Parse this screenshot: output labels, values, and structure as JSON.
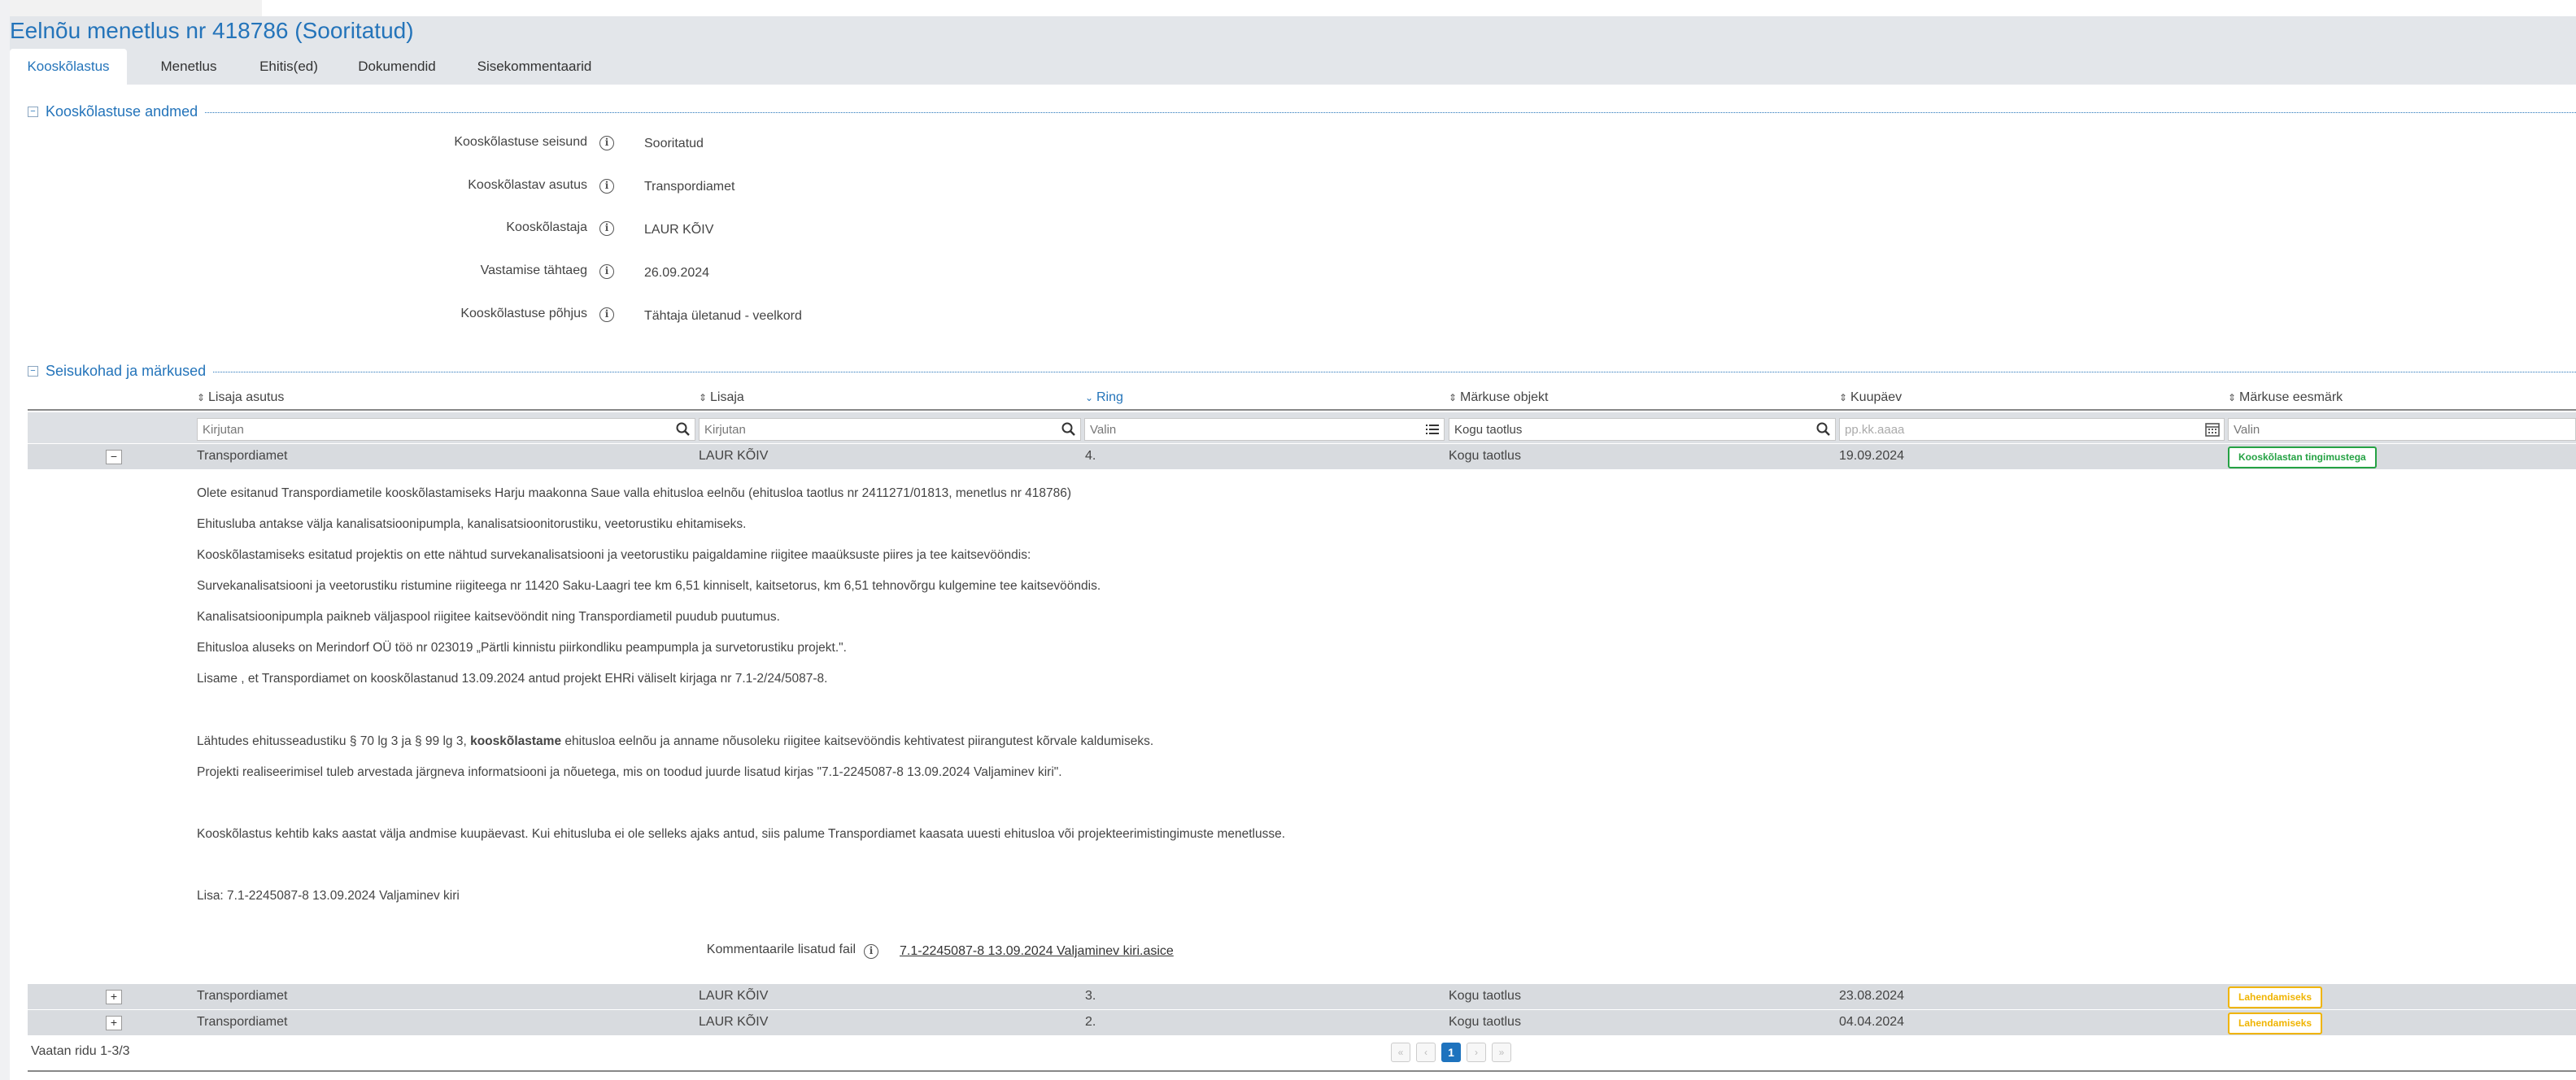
{
  "page": {
    "title": "Eelnõu menetlus nr 418786 (Sooritatud)"
  },
  "tabs": [
    {
      "label": "Kooskõlastus",
      "active": true
    },
    {
      "label": "Menetlus"
    },
    {
      "label": "Ehitis(ed)"
    },
    {
      "label": "Dokumendid"
    },
    {
      "label": "Sisekommentaarid"
    }
  ],
  "section1": {
    "title": "Kooskõlastuse andmed",
    "collapse_glyph": "−",
    "info_glyph": "i",
    "fields": [
      {
        "label": "Kooskõlastuse seisund",
        "value": "Sooritatud"
      },
      {
        "label": "Kooskõlastav asutus",
        "value": "Transpordiamet"
      },
      {
        "label": "Kooskõlastaja",
        "value": "LAUR KÕIV"
      },
      {
        "label": "Vastamise tähtaeg",
        "value": "26.09.2024"
      },
      {
        "label": "Kooskõlastuse põhjus",
        "value": "Tähtaja ületanud - veelkord"
      }
    ]
  },
  "section2": {
    "title": "Seisukohad ja märkused",
    "collapse_glyph": "−",
    "sort_glyph": "⇕",
    "sorted_glyph": "⌄",
    "columns": [
      "Lisaja asutus",
      "Lisaja",
      "Ring",
      "Märkuse objekt",
      "Kuupäev",
      "Märkuse eesmärk"
    ],
    "filters": {
      "asutus": "Kirjutan",
      "lisaja": "Kirjutan",
      "ring": "Valin",
      "objekt": "Kogu taotlus",
      "kuupaev": "pp.kk.aaaa",
      "eesmark": "Valin"
    },
    "rows": [
      {
        "toggle": "−",
        "asutus": "Transpordiamet",
        "lisaja": "LAUR KÕIV",
        "ring": "4.",
        "objekt": "Kogu taotlus",
        "kuupaev": "19.09.2024",
        "eesmark": "Kooskõlastan tingimustega",
        "status_color": "#25a244"
      },
      {
        "toggle": "+",
        "asutus": "Transpordiamet",
        "lisaja": "LAUR KÕIV",
        "ring": "3.",
        "objekt": "Kogu taotlus",
        "kuupaev": "23.08.2024",
        "eesmark": "Lahendamiseks",
        "status_color": "#f0b400"
      },
      {
        "toggle": "+",
        "asutus": "Transpordiamet",
        "lisaja": "LAUR KÕIV",
        "ring": "2.",
        "objekt": "Kogu taotlus",
        "kuupaev": "04.04.2024",
        "eesmark": "Lahendamiseks",
        "status_color": "#f0b400"
      }
    ],
    "comment": {
      "lines": [
        "Olete esitanud Transpordiametile kooskõlastamiseks Harju maakonna Saue valla ehitusloa eelnõu (ehitusloa taotlus nr 2411271/01813, menetlus nr 418786)",
        "Ehitusluba antakse välja kanalisatsioonipumpla, kanalisatsioonitorustiku, veetorustiku ehitamiseks.",
        "Kooskõlastamiseks esitatud projektis on ette nähtud survekanalisatsiooni ja veetorustiku paigaldamine riigitee maaüksuste piires ja tee kaitsevööndis:",
        "Survekanalisatsiooni ja veetorustiku ristumine riigiteega nr 11420 Saku-Laagri tee km 6,51 kinniselt, kaitsetorus, km 6,51 tehnovõrgu kulgemine tee kaitsevööndis.",
        "Kanalisatsioonipumpla paikneb väljaspool riigitee kaitsevööndit ning Transpordiametil puudub puutumus.",
        "Ehitusloa aluseks on Merindorf OÜ töö nr 023019 „Pärtli kinnistu piirkondliku peampumpla ja survetorustiku projekt.\".",
        "Lisame , et Transpordiamet on kooskõlastanud 13.09.2024 antud projekt EHRi väliselt kirjaga nr 7.1-2/24/5087-8."
      ],
      "line8_pre": "Lähtudes ehitusseadustiku § 70 lg 3 ja § 99 lg 3, ",
      "line8_bold": "kooskõlastame",
      "line8_post": " ehitusloa eelnõu ja anname nõusoleku riigitee kaitsevööndis kehtivatest piirangutest kõrvale kaldumiseks.",
      "line9": "Projekti realiseerimisel tuleb arvestada järgneva informatsiooni ja nõuetega, mis on toodud juurde lisatud kirjas \"7.1-2245087-8 13.09.2024 Valjaminev kiri\".",
      "line10": "Kooskõlastus kehtib kaks aastat välja andmise kuupäevast. Kui ehitusluba ei ole selleks ajaks antud, siis palume Transpordiamet kaasata uuesti ehitusloa või projekteerimistingimuste menetlusse.",
      "line11": "Lisa: 7.1-2245087-8 13.09.2024 Valjaminev kiri",
      "file_label": "Kommentaarile lisatud fail",
      "file_name": "7.1-2245087-8 13.09.2024 Valjaminev kiri.asice"
    }
  },
  "footer": {
    "rows_text": "Vaatan ridu 1-3/3",
    "pager": {
      "first": "«",
      "prev": "‹",
      "current": "1",
      "next": "›",
      "last": "»"
    }
  },
  "icons": {
    "search": "search-icon",
    "list": "list-icon",
    "calendar": "calendar-icon",
    "info": "info-icon"
  }
}
